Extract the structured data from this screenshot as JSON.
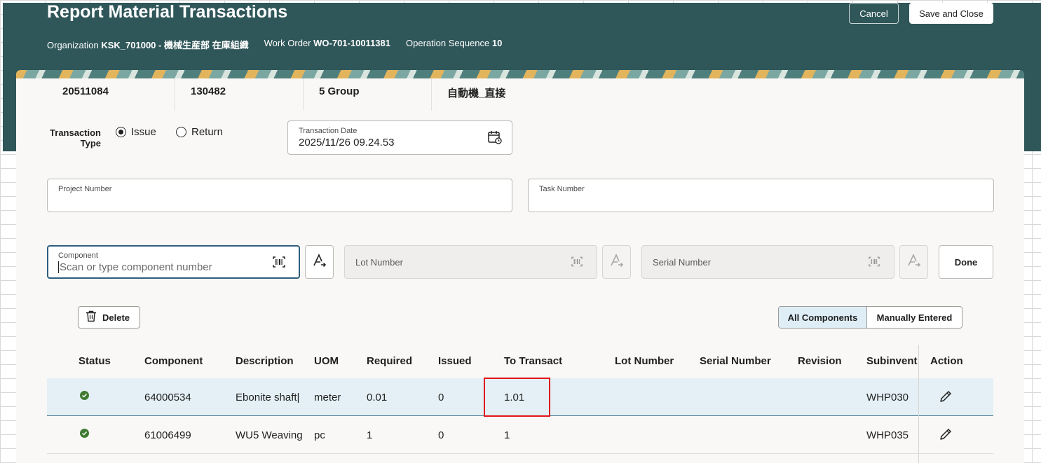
{
  "header": {
    "title": "Report Material Transactions",
    "context": [
      {
        "label": "Organization",
        "value": "KSK_701000 - 機械生産部 在庫組織"
      },
      {
        "label": "Work Order",
        "value": "WO-701-10011381"
      },
      {
        "label": "Operation Sequence",
        "value": "10"
      }
    ],
    "cancel_label": "Cancel",
    "save_label": "Save and Close"
  },
  "info_strip": [
    "20511084",
    "130482",
    "5 Group",
    "自動機_直接"
  ],
  "transaction": {
    "type_label": "Transaction Type",
    "options": [
      {
        "label": "Issue",
        "selected": true
      },
      {
        "label": "Return",
        "selected": false
      }
    ],
    "date_label": "Transaction Date",
    "date_value": "2025/11/26 09.24.53"
  },
  "project": {
    "label": "Project Number",
    "value": ""
  },
  "task": {
    "label": "Task Number",
    "value": ""
  },
  "component": {
    "label": "Component",
    "placeholder": "Scan or type component number"
  },
  "lot": {
    "label": "Lot Number"
  },
  "serial": {
    "label": "Serial Number"
  },
  "done_label": "Done",
  "delete_label": "Delete",
  "filters": {
    "all": "All Components",
    "manual": "Manually Entered",
    "selected": "all"
  },
  "table": {
    "columns": [
      "Status",
      "Component",
      "Description",
      "UOM",
      "Required",
      "Issued",
      "To Transact",
      "Lot Number",
      "Serial Number",
      "Revision",
      "Subinventory",
      "Action"
    ],
    "rows": [
      {
        "status": "ok",
        "component": "64000534",
        "description": "Ebonite shaft|",
        "uom": "meter",
        "required": "0.01",
        "issued": "0",
        "to_transact": "1.01",
        "lot": "",
        "serial": "",
        "revision": "",
        "subinventory": "WHP030"
      },
      {
        "status": "ok",
        "component": "61006499",
        "description": "WU5 Weaving",
        "uom": "pc",
        "required": "1",
        "issued": "0",
        "to_transact": "1",
        "lot": "",
        "serial": "",
        "revision": "",
        "subinventory": "WHP035"
      }
    ]
  },
  "colors": {
    "header_bg": "#2f5659",
    "highlight_border": "#e0141a",
    "status_ok": "#3f7a32",
    "selected_row": "#e4f0f5"
  }
}
